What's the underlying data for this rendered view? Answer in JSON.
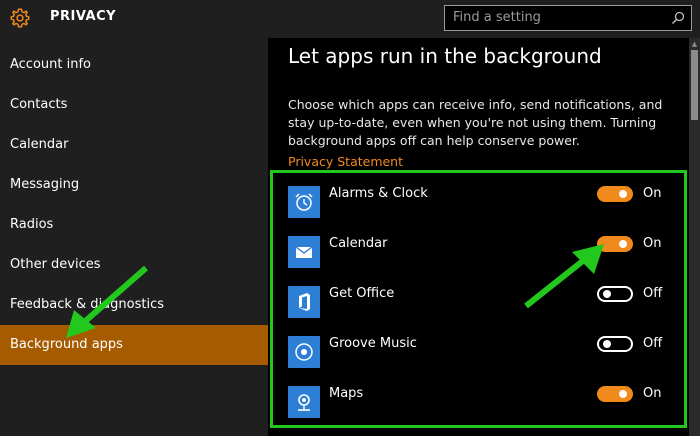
{
  "header": {
    "title": "PRIVACY",
    "search_placeholder": "Find a setting"
  },
  "sidebar": {
    "items": [
      {
        "label": "Account info"
      },
      {
        "label": "Contacts"
      },
      {
        "label": "Calendar"
      },
      {
        "label": "Messaging"
      },
      {
        "label": "Radios"
      },
      {
        "label": "Other devices"
      },
      {
        "label": "Feedback & diagnostics"
      },
      {
        "label": "Background apps",
        "active": true
      }
    ]
  },
  "main": {
    "heading": "Let apps run in the background",
    "description": "Choose which apps can receive info, send notifications, and stay up-to-date, even when you're not using them. Turning background apps off can help conserve power.",
    "privacy_link": "Privacy Statement",
    "apps": [
      {
        "name": "Alarms & Clock",
        "state": "On",
        "icon": "alarm-clock-icon"
      },
      {
        "name": "Calendar",
        "state": "On",
        "icon": "calendar-mail-icon"
      },
      {
        "name": "Get Office",
        "state": "Off",
        "icon": "office-icon"
      },
      {
        "name": "Groove Music",
        "state": "Off",
        "icon": "groove-music-icon"
      },
      {
        "name": "Maps",
        "state": "On",
        "icon": "maps-icon"
      }
    ]
  },
  "colors": {
    "accent": "#f08a1c",
    "active_nav": "#a75b00",
    "tile": "#2d7fd6",
    "annotation": "#22c81e"
  }
}
